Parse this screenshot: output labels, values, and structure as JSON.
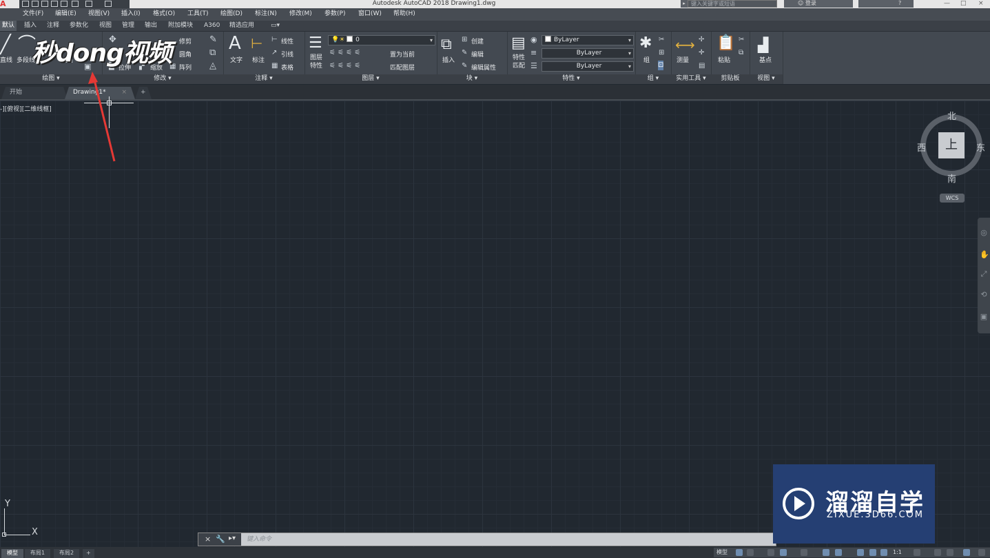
{
  "titlebar": {
    "app_icon": "A",
    "window_title": "Autodesk AutoCAD 2018    Drawing1.dwg",
    "search_placeholder": "键入关键字或短语",
    "signin_label": "登录",
    "window_controls": [
      "—",
      "□",
      "×"
    ]
  },
  "menubar": [
    "文件(F)",
    "编辑(E)",
    "视图(V)",
    "插入(I)",
    "格式(O)",
    "工具(T)",
    "绘图(D)",
    "标注(N)",
    "修改(M)",
    "参数(P)",
    "窗口(W)",
    "帮助(H)"
  ],
  "ribbon_tabs": [
    "默认",
    "插入",
    "注释",
    "参数化",
    "视图",
    "管理",
    "输出",
    "附加模块",
    "A360",
    "精选应用",
    "▭▾"
  ],
  "ribbon": {
    "draw": {
      "title": "绘图 ▾",
      "line": "直线",
      "polyline": "多段线"
    },
    "modify": {
      "title": "修改 ▾",
      "trim": "修剪",
      "fillet": "圆角",
      "stretch": "拉伸",
      "scale": "缩放",
      "array": "阵列"
    },
    "annotation": {
      "title": "注释 ▾",
      "text": "文字",
      "dimension": "标注",
      "linear": "线性",
      "leader": "引线",
      "table": "表格"
    },
    "layers": {
      "title": "图层 ▾",
      "layer_props": "图层\n特性",
      "layer_combo": "0",
      "make_current": "置为当前",
      "match_layer": "匹配图层"
    },
    "block": {
      "title": "块 ▾",
      "insert": "插入",
      "create": "创建",
      "edit": "编辑",
      "edit_attr": "编辑属性"
    },
    "properties": {
      "title": "特性 ▾",
      "match": "特性\n匹配",
      "color": "ByLayer",
      "linetype": "ByLayer",
      "lineweight": "ByLayer"
    },
    "groups": {
      "title": "组 ▾",
      "group": "组"
    },
    "utilities": {
      "title": "实用工具 ▾",
      "measure": "测量"
    },
    "clipboard": {
      "title": "剪贴板",
      "paste": "粘贴"
    },
    "view": {
      "title": "视图 ▾",
      "base": "基点"
    }
  },
  "doc_tabs": [
    "开始",
    "Drawing1*",
    "+"
  ],
  "viewport_label": "-][俯视][二维线框]",
  "viewcube": {
    "face": "上",
    "north": "北",
    "south": "南",
    "east": "东",
    "west": "西",
    "wcs": "WCS"
  },
  "ucs": {
    "x": "X",
    "y": "Y"
  },
  "command_line": {
    "placeholder": "键入命令"
  },
  "layout_tabs": [
    "模型",
    "布局1",
    "布局2",
    "+"
  ],
  "statusbar": {
    "model": "模型",
    "scale": "1:1"
  },
  "watermark": {
    "cn": "溜溜自学",
    "en": "ZIXUE.3D66.COM"
  },
  "brand_overlay": "秒dong视频",
  "colors": {
    "canvas": "#212830",
    "ribbon": "#434951",
    "watermark": "#253f73",
    "arrow": "#e53935"
  }
}
